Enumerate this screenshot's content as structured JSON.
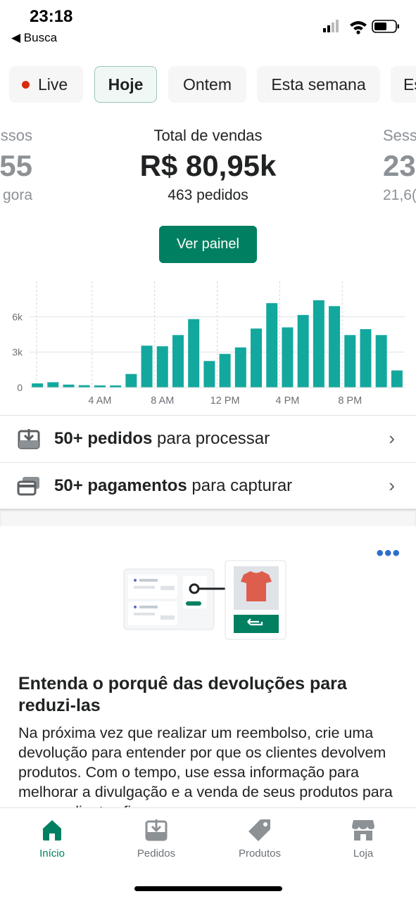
{
  "status_bar": {
    "time": "23:18",
    "back_label": "◀ Busca"
  },
  "chips": [
    {
      "label": "Live",
      "selected": false,
      "dot_color": "#d82c0d"
    },
    {
      "label": "Hoje",
      "selected": true
    },
    {
      "label": "Ontem",
      "selected": false
    },
    {
      "label": "Esta semana",
      "selected": false
    },
    {
      "label": "Es",
      "selected": false
    }
  ],
  "metrics": {
    "left": {
      "title": "ssos",
      "value": "55",
      "sub": "gora"
    },
    "center": {
      "title": "Total de vendas",
      "value": "R$ 80,95k",
      "sub": "463 pedidos"
    },
    "right": {
      "title": "Sess",
      "value": "23",
      "sub": "21,6("
    }
  },
  "panel_button": {
    "label": "Ver painel"
  },
  "chart_data": {
    "type": "bar",
    "bar_color": "#13a89e",
    "y_ticks": [
      "0",
      "3k",
      "6k"
    ],
    "ylim": [
      0,
      9000
    ],
    "x_ticks": [
      {
        "label": "4 AM",
        "index": 4
      },
      {
        "label": "8 AM",
        "index": 8
      },
      {
        "label": "12 PM",
        "index": 12
      },
      {
        "label": "4 PM",
        "index": 16
      },
      {
        "label": "8 PM",
        "index": 20
      }
    ],
    "values": [
      350,
      450,
      250,
      200,
      180,
      180,
      1150,
      3550,
      3500,
      4450,
      5800,
      2250,
      2850,
      3400,
      5000,
      7150,
      5100,
      6150,
      7400,
      6900,
      4450,
      4950,
      4450,
      1450
    ]
  },
  "tasks": [
    {
      "bold": "50+ pedidos",
      "rest": " para processar",
      "icon": "download-box-icon"
    },
    {
      "bold": "50+ pagamentos",
      "rest": " para capturar",
      "icon": "credit-card-icon"
    }
  ],
  "card": {
    "more_label": "•••",
    "title": "Entenda o porquê das devoluções para reduzi-las",
    "body": "Na próxima vez que realizar um reembolso, crie uma devolução para entender por que os clientes devolvem produtos. Com o tempo, use essa informação para melhorar a divulgação e a venda de seus produtos para que os clientes fiquem"
  },
  "tabbar": [
    {
      "label": "Início",
      "icon": "home-icon",
      "active": true
    },
    {
      "label": "Pedidos",
      "icon": "orders-icon",
      "active": false
    },
    {
      "label": "Produtos",
      "icon": "tag-icon",
      "active": false
    },
    {
      "label": "Loja",
      "icon": "store-icon",
      "active": false
    }
  ],
  "colors": {
    "accent": "#008060",
    "link": "#2c6ecb",
    "bars": "#13a89e"
  }
}
